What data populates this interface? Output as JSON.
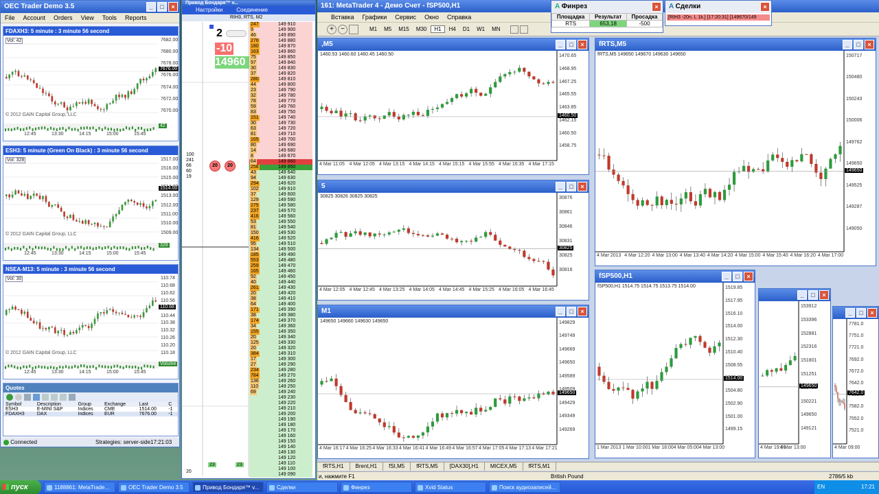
{
  "oec": {
    "title": "OEC Trader Demo 3.5",
    "menu": [
      "File",
      "Account",
      "Orders",
      "View",
      "Tools",
      "Reports"
    ],
    "charts": [
      {
        "title": "FDAXH3: 5 minute : 3 minute 56 second",
        "vol": "Vol: 42",
        "y_ticks": [
          "7682.00",
          "7680.00",
          "7678.00",
          "7676.00",
          "7674.00",
          "7672.00",
          "7670.00"
        ],
        "price_tag": "7676.00",
        "copyright": "© 2012 GAIN Capital Group, LLC",
        "x_ticks": [
          "12:45",
          "13:30",
          "14:15",
          "15:00",
          "15:45"
        ],
        "vol_label": "42"
      },
      {
        "title": "ESH3: 5 minute (Green On Black) : 3 minute 56 second",
        "vol": "Vol: 328",
        "y_ticks": [
          "1517.00",
          "1516.00",
          "1515.00",
          "1514.00",
          "1513.00",
          "1512.00",
          "1511.00",
          "1510.00",
          "1509.00"
        ],
        "price_tag": "1514.00",
        "copyright": "© 2012 GAIN Capital Group, LLC",
        "x_ticks": [
          "12:45",
          "13:30",
          "14:15",
          "15:00",
          "15:45"
        ],
        "vol_label": "328"
      },
      {
        "title": "NSEA-M13: 5 minute : 3 minute 56 second",
        "vol": "Vol: 30",
        "y_ticks": [
          "110.74",
          "110.68",
          "110.62",
          "110.56",
          "110.50",
          "110.44",
          "110.38",
          "110.32",
          "110.26",
          "110.20",
          "110.18"
        ],
        "price_tag": "110.68",
        "copyright": "© 2012 GAIN Capital Group, LLC",
        "x_ticks": [
          "12:45",
          "13:30",
          "14:15",
          "15:00",
          "15:45"
        ],
        "vol_label": "Volume"
      }
    ],
    "quotes": {
      "title": "Quotes",
      "headers": [
        "Symbol",
        "Description",
        "Group",
        "Exchange",
        "Last",
        "C"
      ],
      "rows": [
        [
          "ESH3",
          "E-MINI S&P",
          "Indices",
          "CME",
          "1514.00",
          "-1"
        ],
        [
          "FDAXH3",
          "DAX",
          "Indices",
          "EUR",
          "7676.00",
          "-1"
        ]
      ]
    },
    "status": {
      "left": "Connected",
      "right": "Strategies: server-side",
      "time": "17:21:03"
    }
  },
  "dom": {
    "title": "Привод Бондаря™ v...",
    "menu": [
      "Настройки",
      "Соединение"
    ],
    "subtitle": "RIH3, RTS, M2",
    "top_num": "2",
    "red_num": "-10",
    "green_num": "14960",
    "left_vals": [
      "100",
      "241",
      "66",
      "60",
      "19"
    ],
    "orders": [
      "20",
      "20"
    ],
    "bottom": {
      "a": "23",
      "b": "23",
      "c": "20"
    },
    "prices": [
      "149 910",
      "149 900",
      "149 890",
      "149 880",
      "149 870",
      "149 860",
      "149 850",
      "149 840",
      "149 830",
      "149 820",
      "149 810",
      "149 800",
      "149 790",
      "149 780",
      "149 770",
      "149 760",
      "149 750",
      "149 740",
      "149 730",
      "149 720",
      "149 710",
      "149 700",
      "149 690",
      "149 680",
      "149 670",
      "149 660",
      "149 650",
      "149 640",
      "149 630",
      "149 620",
      "149 610",
      "149 600",
      "149 590",
      "149 580",
      "149 570",
      "149 560",
      "149 550",
      "149 540",
      "149 530",
      "149 520",
      "149 510",
      "149 500",
      "149 490",
      "149 480",
      "149 470",
      "149 460",
      "149 450",
      "149 440",
      "149 430",
      "149 420",
      "149 410",
      "149 400",
      "149 390",
      "149 380",
      "149 370",
      "149 360",
      "149 350",
      "149 340",
      "149 330",
      "149 320",
      "149 310",
      "149 300",
      "149 290",
      "149 280",
      "149 270",
      "149 260",
      "149 250",
      "149 240",
      "149 230",
      "149 220",
      "149 210",
      "149 200",
      "149 190",
      "149 180",
      "149 170",
      "149 160",
      "149 150",
      "149 140",
      "149 130",
      "149 120",
      "149 110",
      "149 100",
      "149 090"
    ],
    "volumes": [
      "247",
      "9",
      "46",
      "276",
      "180",
      "163",
      "75",
      "97",
      "30",
      "37",
      "280",
      "44",
      "23",
      "32",
      "78",
      "59",
      "83",
      "151",
      "30",
      "63",
      "81",
      "165",
      "80",
      "14",
      "8",
      "64",
      "256",
      "43",
      "94",
      "294",
      "102",
      "37",
      "129",
      "275",
      "237",
      "416",
      "53",
      "81",
      "150",
      "416",
      "95",
      "134",
      "185",
      "553",
      "259",
      "165",
      "92",
      "40",
      "261",
      "20",
      "38",
      "64",
      "171",
      "38",
      "174",
      "34",
      "155",
      "20",
      "125",
      "20",
      "384",
      "17",
      "27",
      "234",
      "784",
      "136",
      "110",
      "69"
    ]
  },
  "mt4": {
    "title": "161: MetaTrader 4 - Демо Счет - fSP500,H1",
    "menu": [
      "Вставка",
      "Графики",
      "Сервис",
      "Окно",
      "Справка"
    ],
    "tf": [
      "M1",
      "M5",
      "M15",
      "M30",
      "H1",
      "H4",
      "D1",
      "W1",
      "MN"
    ],
    "charts": [
      {
        "title": ",M5",
        "info": "1460.53 1460.60 1460.45 1460.50",
        "y": [
          "1470.65",
          "1468.95",
          "1467.25",
          "1465.55",
          "1463.85",
          "1462.15",
          "1460.50",
          "1458.75"
        ],
        "tag": "1460.50",
        "x": [
          "4 Mar 11:05",
          "4 Mar 12:05",
          "4 Mar 13:15",
          "4 Mar 14:15",
          "4 Mar 15:15",
          "4 Mar 15:55",
          "4 Mar 16:35",
          "4 Mar 17:15"
        ]
      },
      {
        "title": "fRTS,M5",
        "info": "fRTS,M5  149650 149670 149630 149650",
        "y": [
          "150717",
          "150480",
          "150243",
          "150006",
          "149762",
          "149650",
          "149525",
          "149287",
          "149050"
        ],
        "tag": "149650",
        "x": [
          "4 Mar 2013",
          "4 Mar 12:20",
          "4 Mar 13:00",
          "4 Mar 13:40",
          "4 Mar 14:20",
          "4 Mar 15:00",
          "4 Mar 15:40",
          "4 Mar 16:20",
          "4 Mar 17:00"
        ]
      },
      {
        "title": "5",
        "info": "30825 30826 30825 30825",
        "y": [
          "30876",
          "30861",
          "30846",
          "30831",
          "30825",
          "30816"
        ],
        "tag": "30825",
        "x": [
          "4 Mar 12:05",
          "4 Mar 12:45",
          "4 Mar 13:25",
          "4 Mar 14:05",
          "4 Mar 14:45",
          "4 Mar 15:25",
          "4 Mar 16:05",
          "4 Mar 16:45"
        ]
      },
      {
        "title": "fSP500,H1",
        "info": "fSP500,H1  1514.75 1514.75 1513.75 1514.00",
        "y": [
          "1519.85",
          "1517.95",
          "1516.10",
          "1514.00",
          "1512.30",
          "1510.40",
          "1508.55",
          "1506.65",
          "1504.80",
          "1502.90",
          "1501.00",
          "1499.15"
        ],
        "tag": "1514.00",
        "x": [
          "1 Mar 2013",
          "1 Mar 10:00",
          "1 Mar 18:00",
          "4 Mar 05:00",
          "4 Mar 13:00"
        ]
      },
      {
        "title": "M1",
        "info": "149650 149660 149630 149650",
        "y": [
          "149829",
          "149749",
          "149669",
          "149650",
          "149589",
          "149509",
          "149429",
          "149349",
          "149269"
        ],
        "tag": "149650",
        "x": [
          "4 Mar 16:17",
          "4 Mar 16:25",
          "4 Mar 16:33",
          "4 Mar 16:41",
          "4 Mar 16:49",
          "4 Mar 16:57",
          "4 Mar 17:05",
          "4 Mar 17:13",
          "4 Mar 17:21"
        ]
      },
      {
        "title": "",
        "info": "",
        "y": [
          "153912",
          "153396",
          "152881",
          "152316",
          "151801",
          "151251",
          "150736",
          "150221",
          "149650",
          "149121"
        ],
        "tag": "149650",
        "x": [
          "4 Mar 19:00",
          "4 Mar 13:00"
        ]
      },
      {
        "title": "",
        "info": "",
        "y": [
          "7781.0",
          "7751.0",
          "7721.0",
          "7692.0",
          "7672.0",
          "7642.0",
          "7612.0",
          "7582.0",
          "7552.0",
          "7521.0"
        ],
        "tag": "7642.0",
        "x": [
          "4 Mar 09:00"
        ]
      }
    ],
    "tabs": [
      "fRTS,H1",
      "Brent,H1",
      "fSI,M5",
      "fRTS,M5",
      "[DAX30],H1",
      "MICEX,M5",
      "fRTS,M1"
    ],
    "statusbar": {
      "hint": "и, нажмите F1",
      "profile": "British Pound",
      "traffic": "2786/5 kb"
    }
  },
  "finrez": {
    "title": "Финрез",
    "headers": [
      "Площадка",
      "Результат",
      "Просадка"
    ],
    "row": [
      "RTS",
      "653,18",
      "-500"
    ]
  },
  "sdelki": {
    "title": "Сделки",
    "row": "[RIH3 -20n. L 1k.] [17:20:31] [149670/149"
  },
  "taskbar": {
    "start": "пуск",
    "items": [
      "1188861: MetaTrade...",
      "OEC Trader Demo 3.5",
      "Привод Бондаря™ v...",
      "Сделки",
      "Финрез",
      "Xvid Status",
      "Поиск аудиозаписей..."
    ],
    "lang": "EN",
    "clock": "17:21"
  }
}
